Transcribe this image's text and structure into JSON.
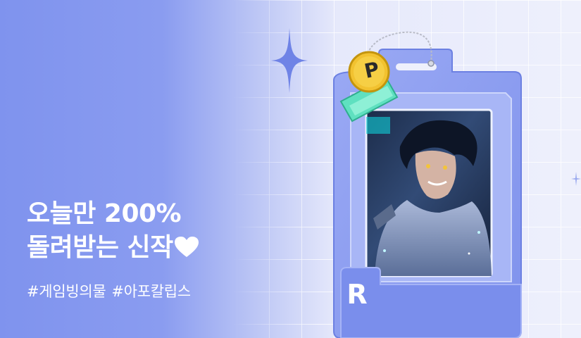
{
  "banner": {
    "headline_line1": "오늘만 200%",
    "headline_line2": "돌려받는 신작",
    "tags": [
      "#게임빙의물",
      "#아포칼립스"
    ],
    "card_badge": "R",
    "keychain_letter": "P",
    "colors": {
      "background": "#7f93ee",
      "card_frame": "#8a9cf2",
      "keychain": "#f2c230",
      "keychain_tag": "#5fe0c0"
    },
    "icons": [
      "heart-icon",
      "sparkle-icon",
      "keychain-icon"
    ]
  }
}
